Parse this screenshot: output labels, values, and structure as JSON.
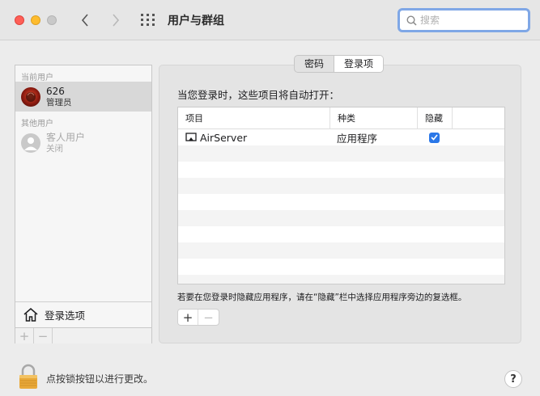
{
  "window": {
    "title": "用户与群组"
  },
  "search": {
    "placeholder": "搜索"
  },
  "sidebar": {
    "current_users_label": "当前用户",
    "current_user": {
      "name": "626",
      "role": "管理员"
    },
    "other_users_label": "其他用户",
    "guest_user": {
      "name": "客人用户",
      "status": "关闭"
    },
    "login_options_label": "登录选项",
    "add_label": "+",
    "remove_label": "−"
  },
  "tabs": [
    {
      "label": "密码",
      "active": false
    },
    {
      "label": "登录项",
      "active": true
    }
  ],
  "login_items": {
    "description": "当您登录时，这些项目将自动打开：",
    "columns": [
      "项目",
      "种类",
      "隐藏"
    ],
    "rows": [
      {
        "item": "AirServer",
        "kind": "应用程序",
        "hidden": true
      }
    ],
    "hint": "若要在您登录时隐藏应用程序，请在“隐藏”栏中选择应用程序旁边的复选框。",
    "add_label": "+",
    "remove_label": "−"
  },
  "footer": {
    "lock_text": "点按锁按钮以进行更改。",
    "help_label": "?"
  },
  "colors": {
    "accent": "#2a77e8",
    "search_focus": "#7fa7e6"
  }
}
